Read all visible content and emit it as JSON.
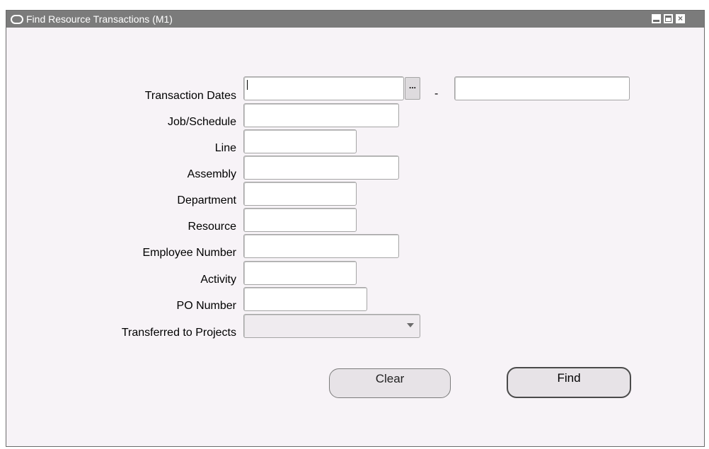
{
  "window": {
    "title": "Find Resource Transactions (M1)",
    "close_glyph": "×"
  },
  "form": {
    "transaction_dates_label": "Transaction Dates",
    "date_separator": "-",
    "lov_glyph": "...",
    "job_schedule_label": "Job/Schedule",
    "line_label": "Line",
    "assembly_label": "Assembly",
    "department_label": "Department",
    "resource_label": "Resource",
    "employee_number_label": "Employee Number",
    "activity_label": "Activity",
    "po_number_label": "PO Number",
    "transferred_to_projects_label": "Transferred to Projects"
  },
  "buttons": {
    "clear_label": "Clear",
    "find_label": "Find"
  }
}
